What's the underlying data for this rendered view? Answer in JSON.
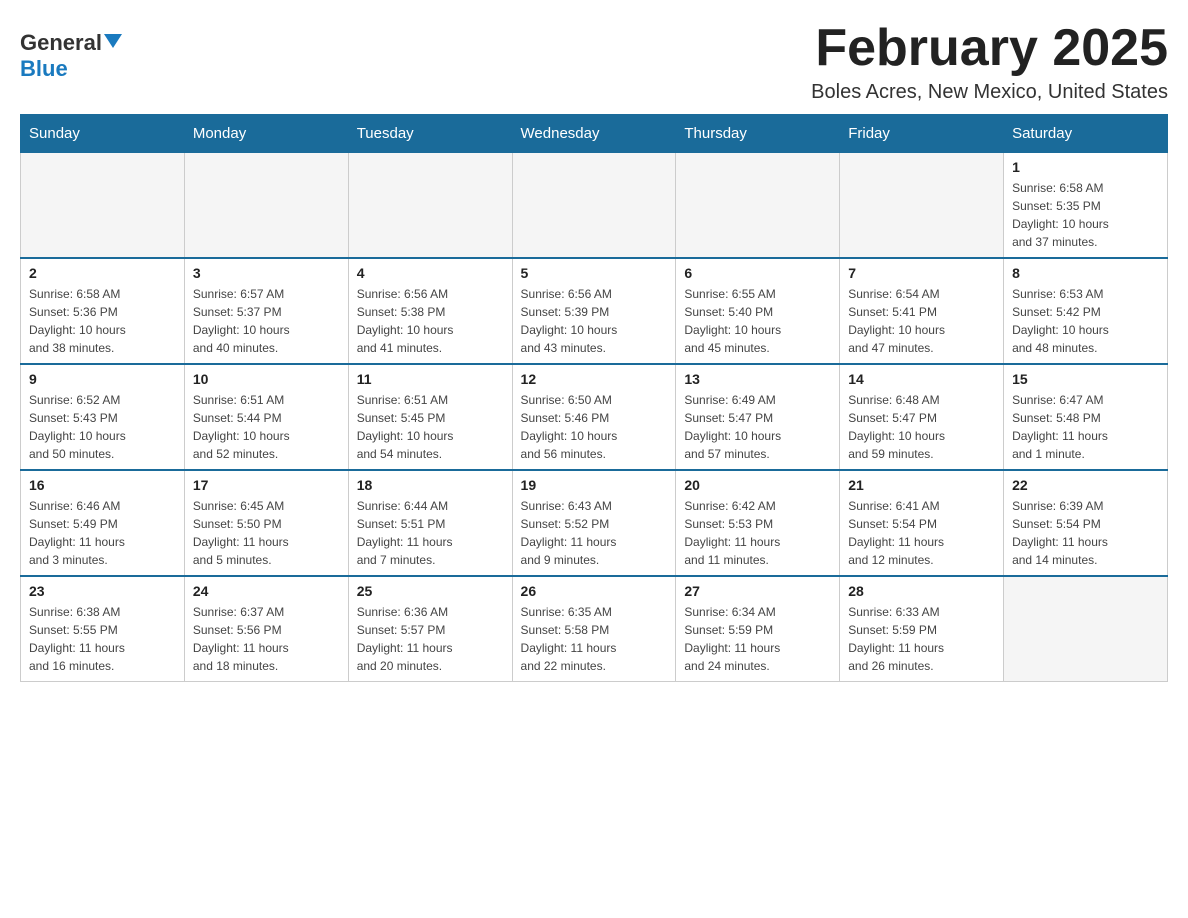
{
  "header": {
    "logo_general": "General",
    "logo_blue": "Blue",
    "month_title": "February 2025",
    "location": "Boles Acres, New Mexico, United States"
  },
  "weekdays": [
    "Sunday",
    "Monday",
    "Tuesday",
    "Wednesday",
    "Thursday",
    "Friday",
    "Saturday"
  ],
  "weeks": [
    [
      {
        "day": "",
        "info": ""
      },
      {
        "day": "",
        "info": ""
      },
      {
        "day": "",
        "info": ""
      },
      {
        "day": "",
        "info": ""
      },
      {
        "day": "",
        "info": ""
      },
      {
        "day": "",
        "info": ""
      },
      {
        "day": "1",
        "info": "Sunrise: 6:58 AM\nSunset: 5:35 PM\nDaylight: 10 hours\nand 37 minutes."
      }
    ],
    [
      {
        "day": "2",
        "info": "Sunrise: 6:58 AM\nSunset: 5:36 PM\nDaylight: 10 hours\nand 38 minutes."
      },
      {
        "day": "3",
        "info": "Sunrise: 6:57 AM\nSunset: 5:37 PM\nDaylight: 10 hours\nand 40 minutes."
      },
      {
        "day": "4",
        "info": "Sunrise: 6:56 AM\nSunset: 5:38 PM\nDaylight: 10 hours\nand 41 minutes."
      },
      {
        "day": "5",
        "info": "Sunrise: 6:56 AM\nSunset: 5:39 PM\nDaylight: 10 hours\nand 43 minutes."
      },
      {
        "day": "6",
        "info": "Sunrise: 6:55 AM\nSunset: 5:40 PM\nDaylight: 10 hours\nand 45 minutes."
      },
      {
        "day": "7",
        "info": "Sunrise: 6:54 AM\nSunset: 5:41 PM\nDaylight: 10 hours\nand 47 minutes."
      },
      {
        "day": "8",
        "info": "Sunrise: 6:53 AM\nSunset: 5:42 PM\nDaylight: 10 hours\nand 48 minutes."
      }
    ],
    [
      {
        "day": "9",
        "info": "Sunrise: 6:52 AM\nSunset: 5:43 PM\nDaylight: 10 hours\nand 50 minutes."
      },
      {
        "day": "10",
        "info": "Sunrise: 6:51 AM\nSunset: 5:44 PM\nDaylight: 10 hours\nand 52 minutes."
      },
      {
        "day": "11",
        "info": "Sunrise: 6:51 AM\nSunset: 5:45 PM\nDaylight: 10 hours\nand 54 minutes."
      },
      {
        "day": "12",
        "info": "Sunrise: 6:50 AM\nSunset: 5:46 PM\nDaylight: 10 hours\nand 56 minutes."
      },
      {
        "day": "13",
        "info": "Sunrise: 6:49 AM\nSunset: 5:47 PM\nDaylight: 10 hours\nand 57 minutes."
      },
      {
        "day": "14",
        "info": "Sunrise: 6:48 AM\nSunset: 5:47 PM\nDaylight: 10 hours\nand 59 minutes."
      },
      {
        "day": "15",
        "info": "Sunrise: 6:47 AM\nSunset: 5:48 PM\nDaylight: 11 hours\nand 1 minute."
      }
    ],
    [
      {
        "day": "16",
        "info": "Sunrise: 6:46 AM\nSunset: 5:49 PM\nDaylight: 11 hours\nand 3 minutes."
      },
      {
        "day": "17",
        "info": "Sunrise: 6:45 AM\nSunset: 5:50 PM\nDaylight: 11 hours\nand 5 minutes."
      },
      {
        "day": "18",
        "info": "Sunrise: 6:44 AM\nSunset: 5:51 PM\nDaylight: 11 hours\nand 7 minutes."
      },
      {
        "day": "19",
        "info": "Sunrise: 6:43 AM\nSunset: 5:52 PM\nDaylight: 11 hours\nand 9 minutes."
      },
      {
        "day": "20",
        "info": "Sunrise: 6:42 AM\nSunset: 5:53 PM\nDaylight: 11 hours\nand 11 minutes."
      },
      {
        "day": "21",
        "info": "Sunrise: 6:41 AM\nSunset: 5:54 PM\nDaylight: 11 hours\nand 12 minutes."
      },
      {
        "day": "22",
        "info": "Sunrise: 6:39 AM\nSunset: 5:54 PM\nDaylight: 11 hours\nand 14 minutes."
      }
    ],
    [
      {
        "day": "23",
        "info": "Sunrise: 6:38 AM\nSunset: 5:55 PM\nDaylight: 11 hours\nand 16 minutes."
      },
      {
        "day": "24",
        "info": "Sunrise: 6:37 AM\nSunset: 5:56 PM\nDaylight: 11 hours\nand 18 minutes."
      },
      {
        "day": "25",
        "info": "Sunrise: 6:36 AM\nSunset: 5:57 PM\nDaylight: 11 hours\nand 20 minutes."
      },
      {
        "day": "26",
        "info": "Sunrise: 6:35 AM\nSunset: 5:58 PM\nDaylight: 11 hours\nand 22 minutes."
      },
      {
        "day": "27",
        "info": "Sunrise: 6:34 AM\nSunset: 5:59 PM\nDaylight: 11 hours\nand 24 minutes."
      },
      {
        "day": "28",
        "info": "Sunrise: 6:33 AM\nSunset: 5:59 PM\nDaylight: 11 hours\nand 26 minutes."
      },
      {
        "day": "",
        "info": ""
      }
    ]
  ]
}
